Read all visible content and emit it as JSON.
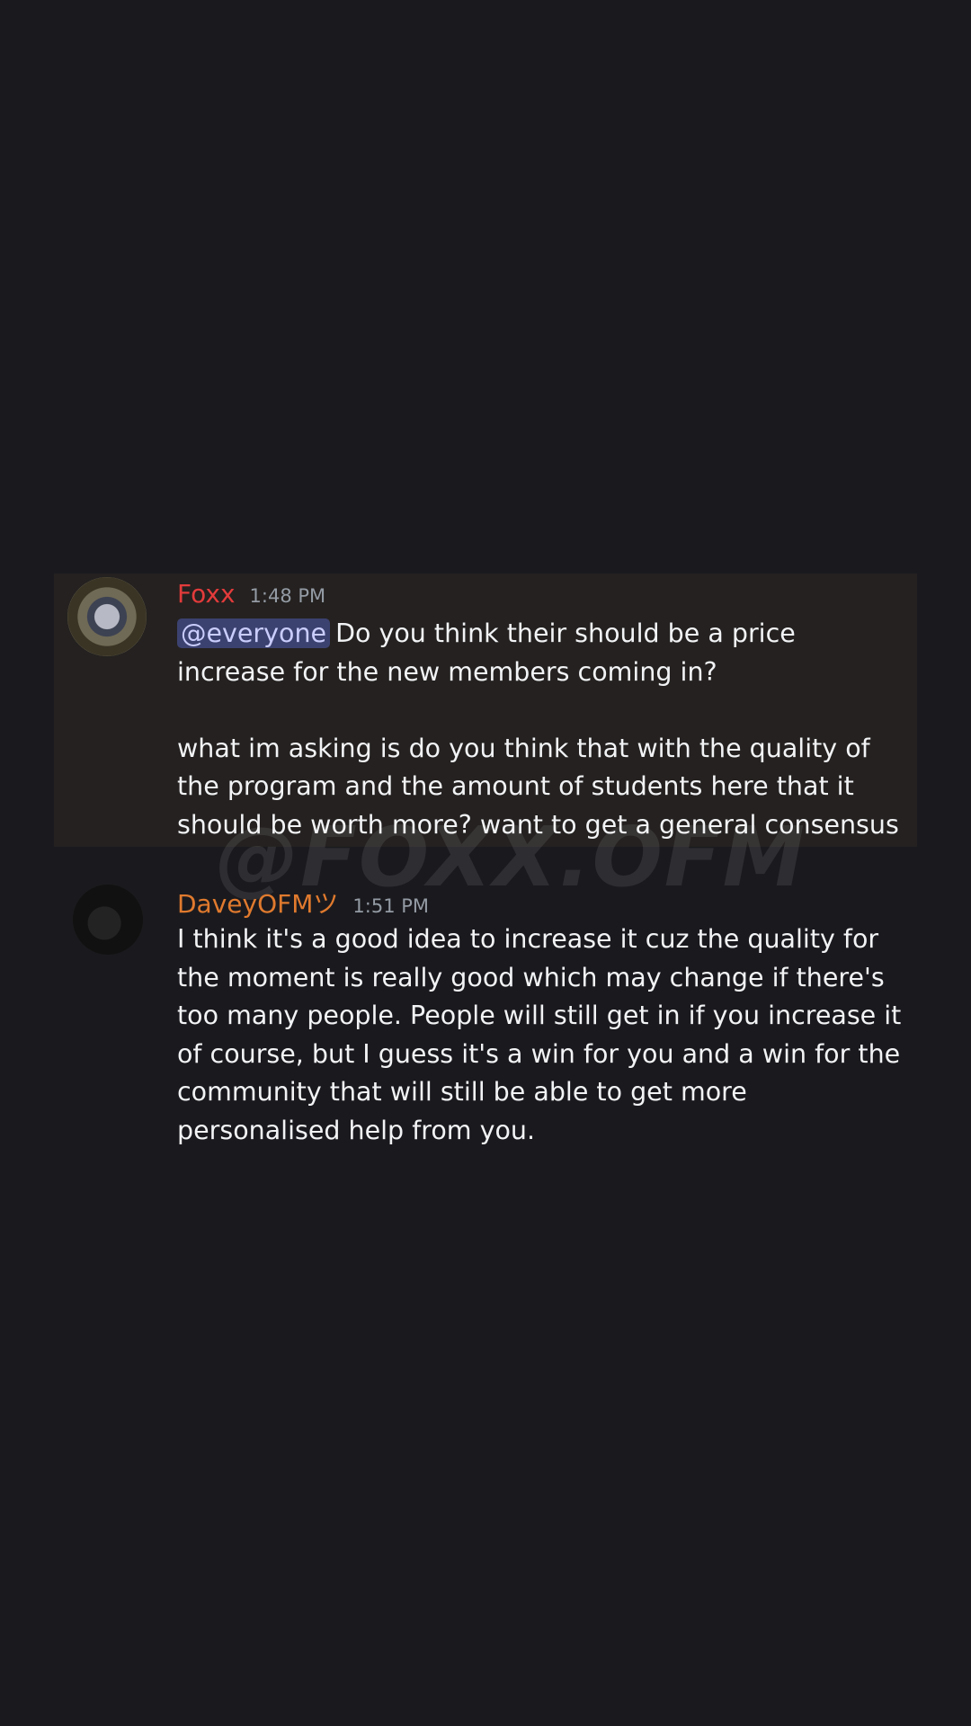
{
  "messages": [
    {
      "username": "Foxx",
      "username_color": "#e33b3b",
      "timestamp": "1:48 PM",
      "mention": "@everyone",
      "line1": "Do you think their should be a price increase for the new members coming in?",
      "line2": "what im asking is do you think that with the quality of the program and the amount of students here that it should be worth more? want to get a general consensus"
    },
    {
      "username": "DaveyOFMツ",
      "username_color": "#e07a2e",
      "timestamp": "1:51 PM",
      "text": "I think it's a good idea to increase it cuz the quality for the moment is really good which may change if there's too many people. People will still get in if you increase it of course, but I guess it's a win for you and a win for the community that will still be able to get more personalised help from you."
    }
  ],
  "watermark": "@FOXX.OFM",
  "colors": {
    "background": "#1a1a1e",
    "highlight": "#242120",
    "mention_bg": "#3c4270",
    "mention_text": "#c9cdfb",
    "timestamp": "#949ba4"
  }
}
